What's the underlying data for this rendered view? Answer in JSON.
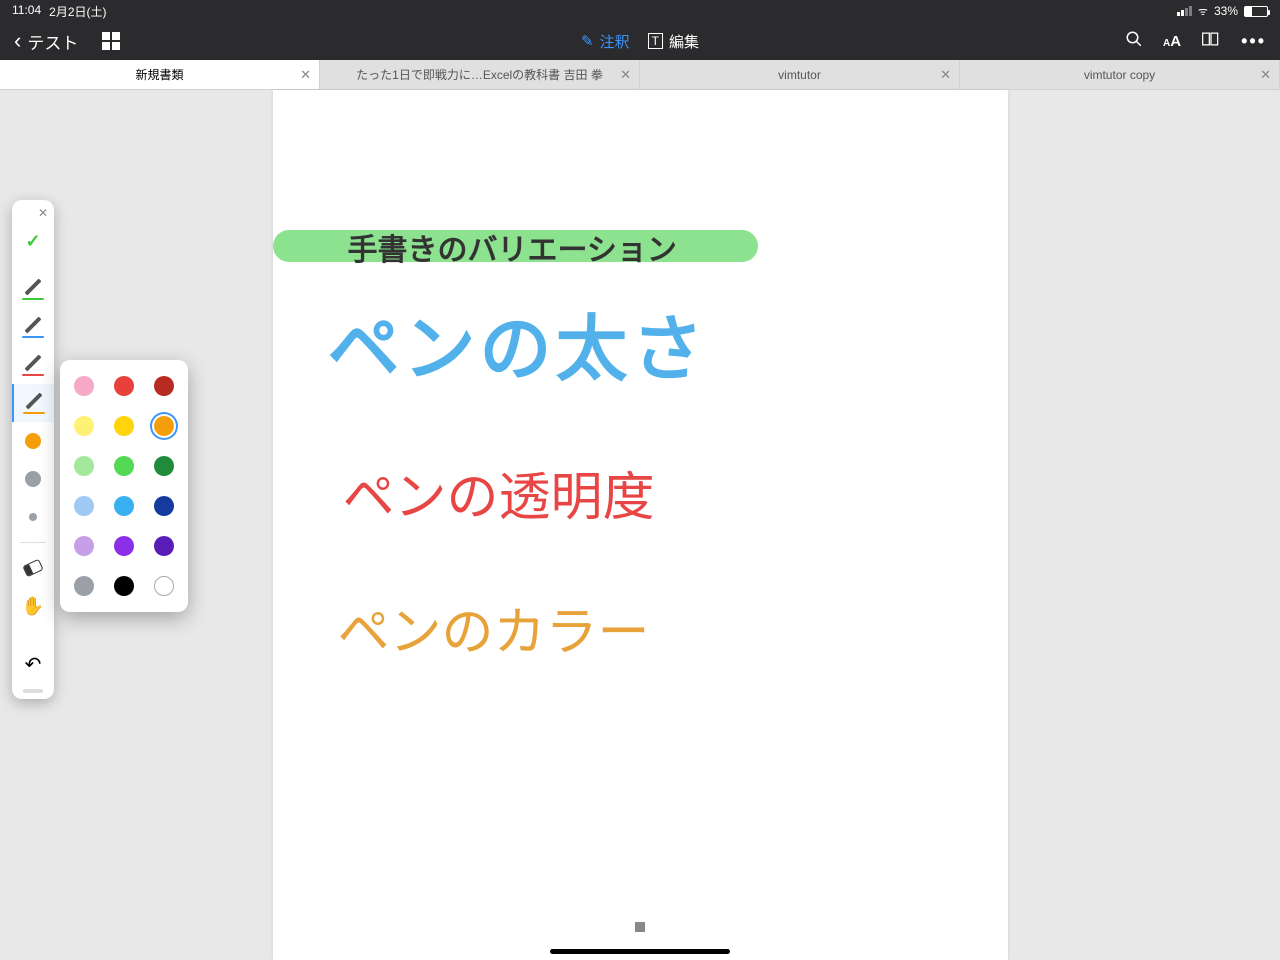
{
  "status": {
    "time": "11:04",
    "date": "2月2日(土)",
    "battery": "33%"
  },
  "toolbar": {
    "back_label": "テスト",
    "annotate": "注釈",
    "edit": "編集"
  },
  "tabs": [
    {
      "label": "新規書類",
      "active": true
    },
    {
      "label": "たった1日で即戦力に…Excelの教科書 吉田 拳",
      "active": false
    },
    {
      "label": "vimtutor",
      "active": false
    },
    {
      "label": "vimtutor copy",
      "active": false
    }
  ],
  "handwriting": {
    "title": "手書きのバリエーション",
    "blue": "ペンの太さ",
    "red": "ペンの透明度",
    "orange": "ペンのカラー"
  },
  "pen_tools": {
    "underlines": [
      "#3ac93a",
      "#3a95ff",
      "#e84545",
      "#f59e0b"
    ],
    "current_color": "#f59e0b",
    "gray": "#9aa0a6",
    "small_gray": "#9aa0a6"
  },
  "palette": {
    "colors": [
      "#f5a9c7",
      "#e8403a",
      "#b82b20",
      "#fff176",
      "#ffd40a",
      "#f59e0b",
      "#a4e89b",
      "#54d954",
      "#1f8b3b",
      "#9fc9f5",
      "#39b0ef",
      "#163a9e",
      "#c79fe8",
      "#8b30e8",
      "#5a1db8",
      "#9aa0a6",
      "#000000",
      "white"
    ],
    "selected_index": 5
  }
}
